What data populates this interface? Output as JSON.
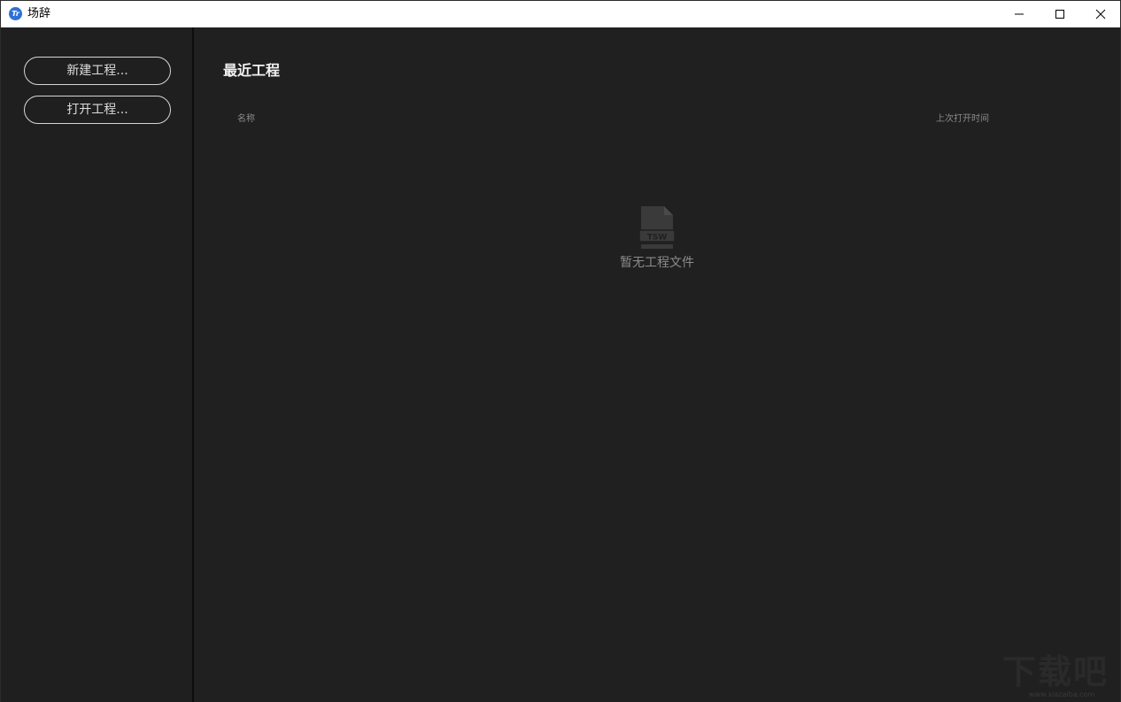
{
  "window": {
    "title": "场辞",
    "logo_text": "Tr"
  },
  "sidebar": {
    "new_project_label": "新建工程...",
    "open_project_label": "打开工程..."
  },
  "main": {
    "section_title": "最近工程",
    "columns": {
      "name": "名称",
      "last_opened": "上次打开时间"
    },
    "empty_state": {
      "icon_label": "TSW",
      "message": "暂无工程文件"
    }
  },
  "watermark": {
    "text": "下载吧",
    "url": "www.xiazaiba.com"
  }
}
